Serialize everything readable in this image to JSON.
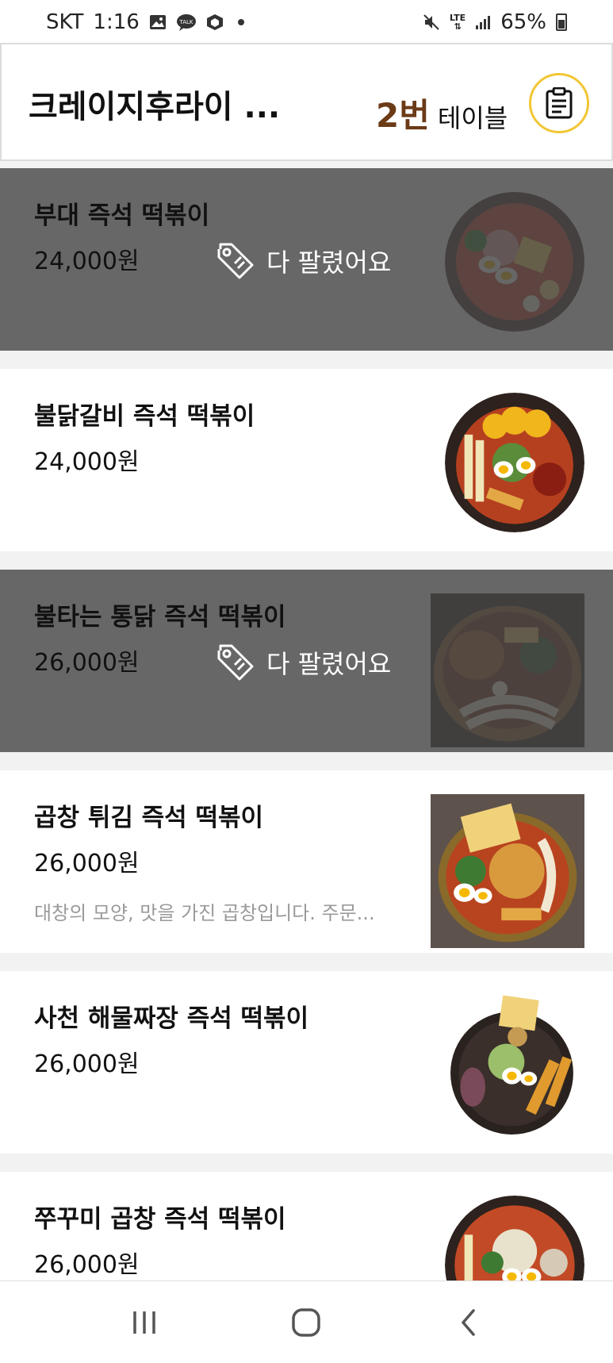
{
  "status_bar": {
    "carrier": "SKT",
    "time": "1:16",
    "network": "LTE",
    "battery": "65%"
  },
  "header": {
    "store_name": "크레이지후라이 ...",
    "table_number": "2번",
    "table_word": "테이블"
  },
  "sold_out_label": "다 팔렸어요",
  "menu_items": [
    {
      "name": "부대 즉석 떡볶이",
      "price": "24,000원",
      "description": "",
      "sold_out": true
    },
    {
      "name": "불닭갈비 즉석 떡볶이",
      "price": "24,000원",
      "description": "",
      "sold_out": false
    },
    {
      "name": "불타는 통닭 즉석 떡볶이",
      "price": "26,000원",
      "description": "",
      "sold_out": true
    },
    {
      "name": "곱창 튀김 즉석 떡볶이",
      "price": "26,000원",
      "description": "대창의 모양, 맛을 가진 곱창입니다. 주문...",
      "sold_out": false
    },
    {
      "name": "사천 해물짜장 즉석 떡볶이",
      "price": "26,000원",
      "description": "",
      "sold_out": false
    },
    {
      "name": "쭈꾸미 곱창 즉석 떡볶이",
      "price": "26,000원",
      "description": "",
      "sold_out": false
    }
  ],
  "colors": {
    "accent": "#6b3a17",
    "ring": "#f2c634",
    "soldout_overlay": "#464646"
  }
}
